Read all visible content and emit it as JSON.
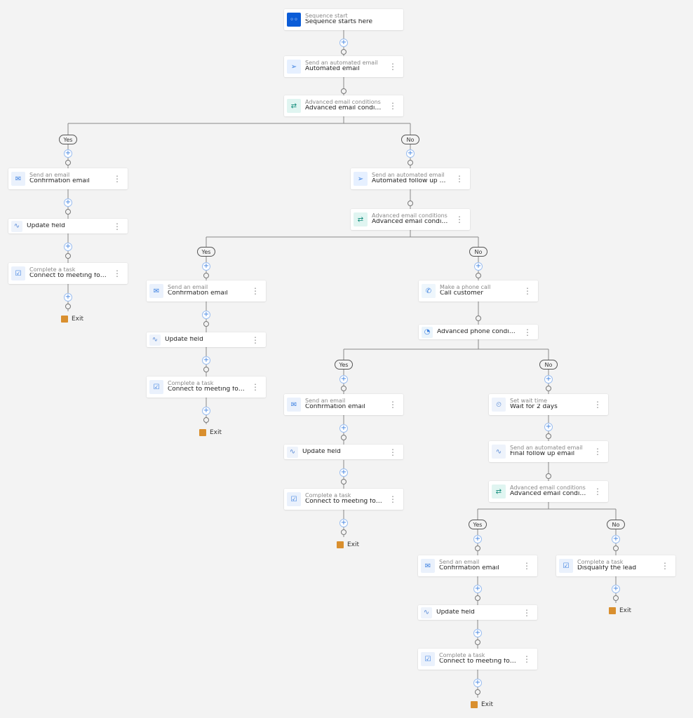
{
  "seq": {
    "sub": "Sequence start",
    "title": "Sequence starts here"
  },
  "auto_email": {
    "sub": "Send an automated email",
    "title": "Automated email"
  },
  "cond": {
    "sub": "Advanced email conditions",
    "title": "Advanced email conditions"
  },
  "email": {
    "sub": "Send an email",
    "title": "Confirmation email"
  },
  "update": {
    "title": "Update field"
  },
  "task": {
    "sub": "Complete a task",
    "title": "Connect to meeting for product demo r..."
  },
  "followup": {
    "sub": "Send an automated email",
    "title": "Automated follow up email"
  },
  "phone": {
    "sub": "Make a phone call",
    "title": "Call customer"
  },
  "pcond": {
    "title": "Advanced phone condition"
  },
  "wait": {
    "sub": "Set wait time",
    "title": "Wait for 2 days"
  },
  "final": {
    "sub": "Send an automated email",
    "title": "Final follow up email"
  },
  "disq": {
    "sub": "Complete a task",
    "title": "Disqualify the lead"
  },
  "labels": {
    "yes": "Yes",
    "no": "No",
    "exit": "Exit"
  }
}
